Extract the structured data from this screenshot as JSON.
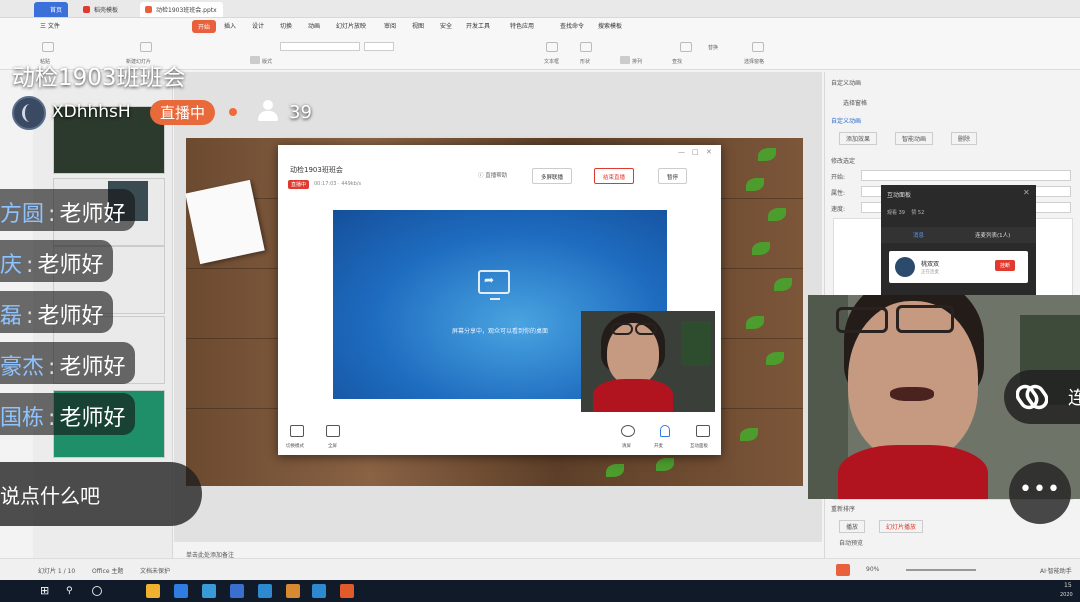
{
  "stream": {
    "title": "动检1903班班会",
    "host_name": "XDhhhsH",
    "live_badge": "直播中",
    "viewer_count": "39",
    "chat_placeholder": "说点什么吧",
    "connect_label": "连",
    "more_label": "•••"
  },
  "comments": [
    {
      "user": "方圆",
      "message": "老师好"
    },
    {
      "user": "庆",
      "message": "老师好"
    },
    {
      "user": "磊",
      "message": "老师好"
    },
    {
      "user": "豪杰",
      "message": "老师好"
    },
    {
      "user": "国栋",
      "message": "老师好"
    }
  ],
  "wps": {
    "tabs": [
      "首页",
      "稻壳模板",
      "动检1903班班会.pptx"
    ],
    "menu": [
      "三 文件",
      "开始",
      "插入",
      "设计",
      "切换",
      "动画",
      "幻灯片放映",
      "审阅",
      "视图",
      "安全",
      "开发工具",
      "特色应用",
      "查找命令",
      "搜索模板"
    ],
    "ribbon_labels": [
      "粘贴",
      "新建幻灯片",
      "版式",
      "节",
      "文本框",
      "形状",
      "排列",
      "查找",
      "替换",
      "选择窗格"
    ],
    "right_pane": {
      "title": "自定义动画",
      "select_pane": "选择窗格",
      "custom_anim": "自定义动画",
      "add_effect": "添加效果",
      "smart_anim": "智能动画",
      "delete": "删除",
      "modify": "修改选定",
      "start": "开始:",
      "property": "属性:",
      "speed": "速度:",
      "reorder": "重新排序",
      "play": "播放",
      "slideshow": "幻灯片播放",
      "auto_preview": "自动预览"
    },
    "status": {
      "slide_count": "幻灯片 1 / 10",
      "theme": "Office 主题",
      "protect": "文档未保护",
      "notes": "单击此处添加备注",
      "zoom": "90%",
      "ai": "AI·智能助手"
    }
  },
  "dialog": {
    "title": "动检1903班班会",
    "live_tag": "直播中",
    "time": "00:17:03 · 449kb/s",
    "help": "直播帮助",
    "btn_multi": "多屏联播",
    "btn_end": "结束直播",
    "btn_pause": "暂停",
    "share_text": "屏幕分享中，观众可以看到你的桌面",
    "left_icons": [
      "切换模式",
      "全屏"
    ],
    "right_icons": [
      "清屏",
      "开麦",
      "互动面板"
    ]
  },
  "interact_panel": {
    "title": "互动面板",
    "viewers": "观看 39",
    "likes": "赞 52",
    "tab_comments": "消息",
    "tab_queue": "连麦列表(1人)",
    "card_name": "桃双双",
    "card_sub": "正在连麦",
    "card_btn": "挂断"
  },
  "taskbar": {
    "time": "15",
    "date": "2020"
  },
  "colors": {
    "live_badge": "#e86a3a",
    "wps_accent": "#e8603c",
    "end_button": "#e0392f",
    "comment_user": "#8fc3ff"
  }
}
